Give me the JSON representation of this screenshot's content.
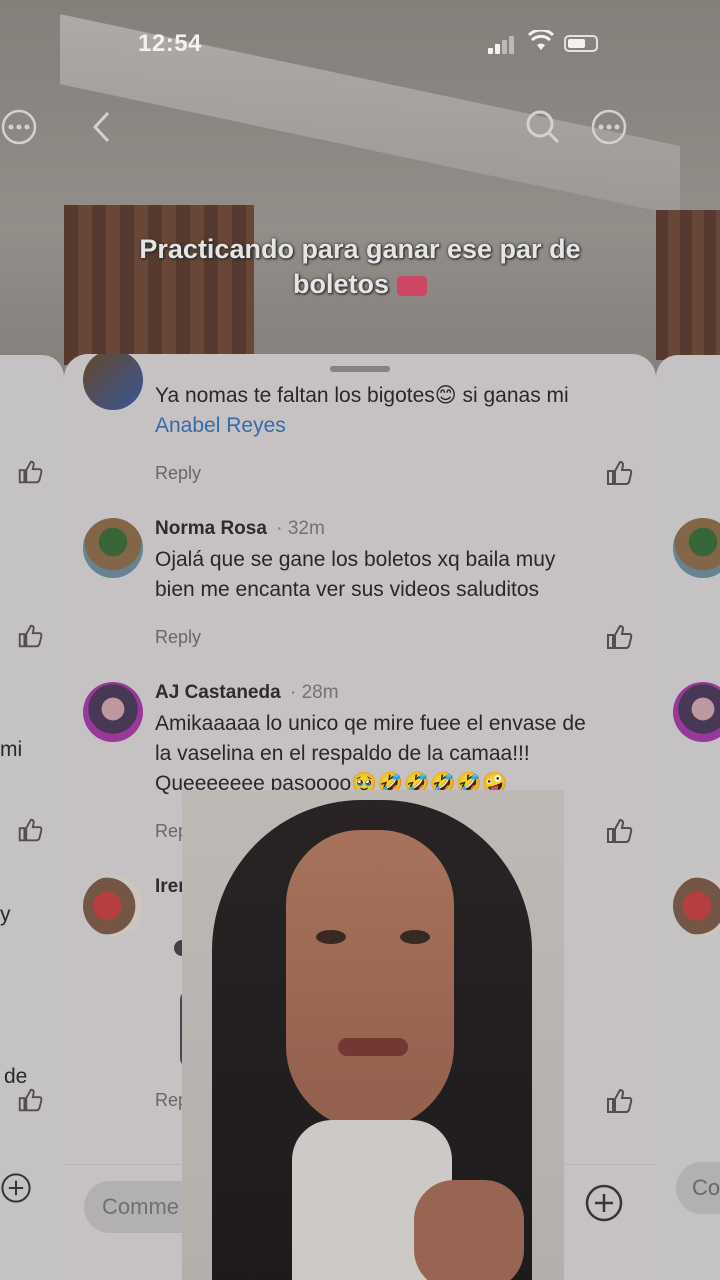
{
  "status_bar": {
    "time": "12:54"
  },
  "video": {
    "caption_line1": "Practicando para ganar ese par de",
    "caption_line2": "boletos"
  },
  "comments": [
    {
      "name": "",
      "time": "",
      "text": "Ya nomas te faltan los bigotes😊 si ganas mi",
      "mention": "Anabel Reyes",
      "reply_label": "Reply"
    },
    {
      "name": "Norma Rosa",
      "time": "32m",
      "text_line1": "Ojalá  que se gane los boletos xq baila muy",
      "text_line2": "bien me encanta ver sus videos  saluditos",
      "reply_label": "Reply"
    },
    {
      "name": "AJ Castaneda",
      "time": "28m",
      "text_line1": "Amikaaaaa lo unico qe mire fuee el envase de",
      "text_line2": "la vaselina en el respaldo de la camaa!!!",
      "text_line3": "Queeeeeee pasoooo🥹🤣🤣🤣🤣🤪",
      "reply_label": "Reply"
    },
    {
      "name": "Irene N Eliasa",
      "reply_label": "Rep"
    }
  ],
  "side_fragments": {
    "left_mi": "mi",
    "left_de": "de",
    "left_y": "y",
    "right_co": "Co"
  },
  "comment_input": {
    "placeholder": "Comme"
  },
  "colors": {
    "sheet_bg": "#d1cdcf",
    "mention": "#3a6fb0"
  }
}
